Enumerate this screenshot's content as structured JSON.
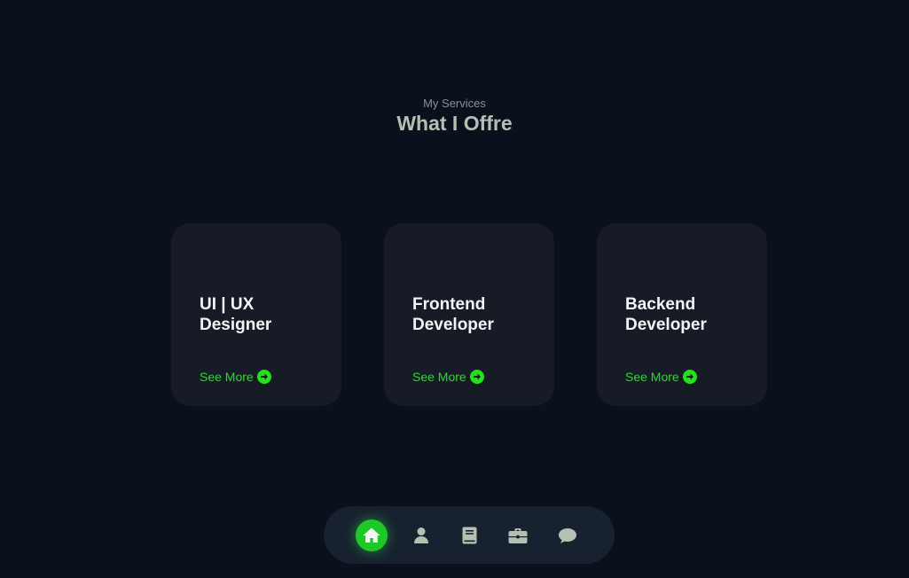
{
  "header": {
    "subtitle": "My Services",
    "title": "What I Offre"
  },
  "services": [
    {
      "title": "UI | UX\nDesigner",
      "link_label": "See More"
    },
    {
      "title": "Frontend\nDeveloper",
      "link_label": "See More"
    },
    {
      "title": "Backend\nDeveloper",
      "link_label": "See More"
    }
  ],
  "nav": {
    "items": [
      {
        "icon": "home-icon",
        "active": true
      },
      {
        "icon": "user-icon",
        "active": false
      },
      {
        "icon": "book-icon",
        "active": false
      },
      {
        "icon": "briefcase-icon",
        "active": false
      },
      {
        "icon": "chat-icon",
        "active": false
      }
    ]
  },
  "colors": {
    "background": "#0b101d",
    "card": "#161b26",
    "accent": "#22e31b",
    "nav_bg": "#182130",
    "nav_icon": "#b3c0b2"
  }
}
